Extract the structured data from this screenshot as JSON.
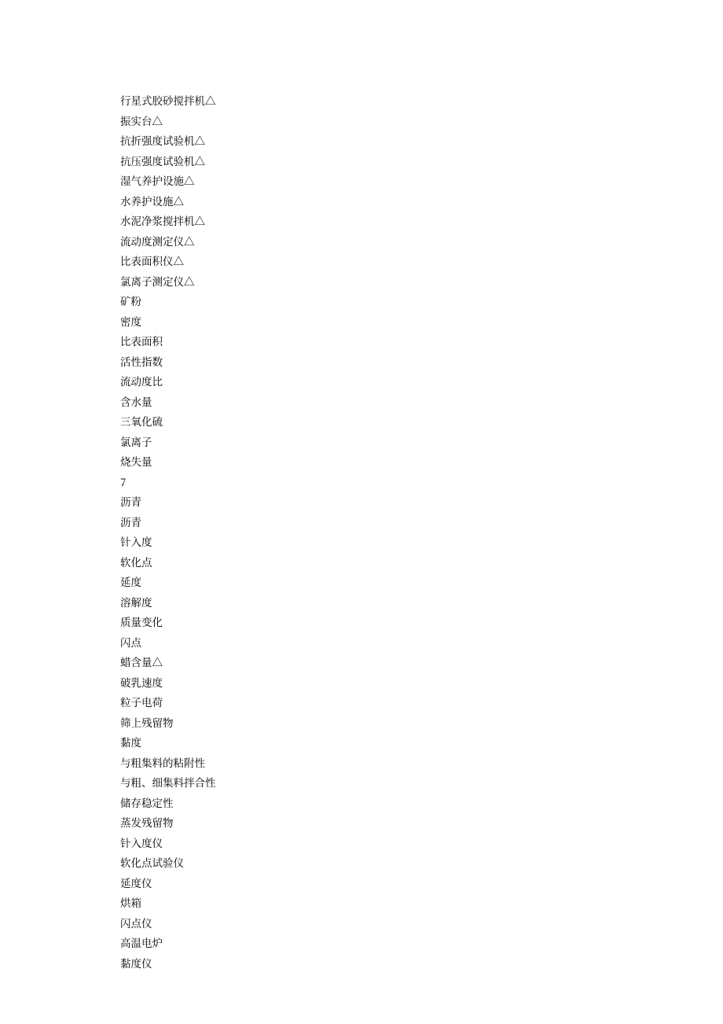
{
  "lines": [
    "行星式胶砂搅拌机△",
    "振实台△",
    "抗折强度试验机△",
    "抗压强度试验机△",
    "湿气养护设施△",
    "水养护设施△",
    "水泥净浆搅拌机△",
    "流动度测定仪△",
    "比表面积仪△",
    "氯离子测定仪△",
    "矿粉",
    "密度",
    "比表面积",
    "活性指数",
    "流动度比",
    "含水量",
    "三氧化硫",
    "氯离子",
    "烧失量",
    "7",
    "沥青",
    "沥青",
    "针入度",
    "软化点",
    "延度",
    "溶解度",
    "质量变化",
    "闪点",
    "蜡含量△",
    "破乳速度",
    "粒子电荷",
    "筛上残留物",
    "黏度",
    "与粗集料的粘附性",
    "与粗、细集料拌合性",
    "储存稳定性",
    "蒸发残留物",
    "针入度仪",
    "软化点试验仪",
    "延度仪",
    "烘箱",
    "闪点仪",
    "高温电炉",
    "黏度仪"
  ]
}
